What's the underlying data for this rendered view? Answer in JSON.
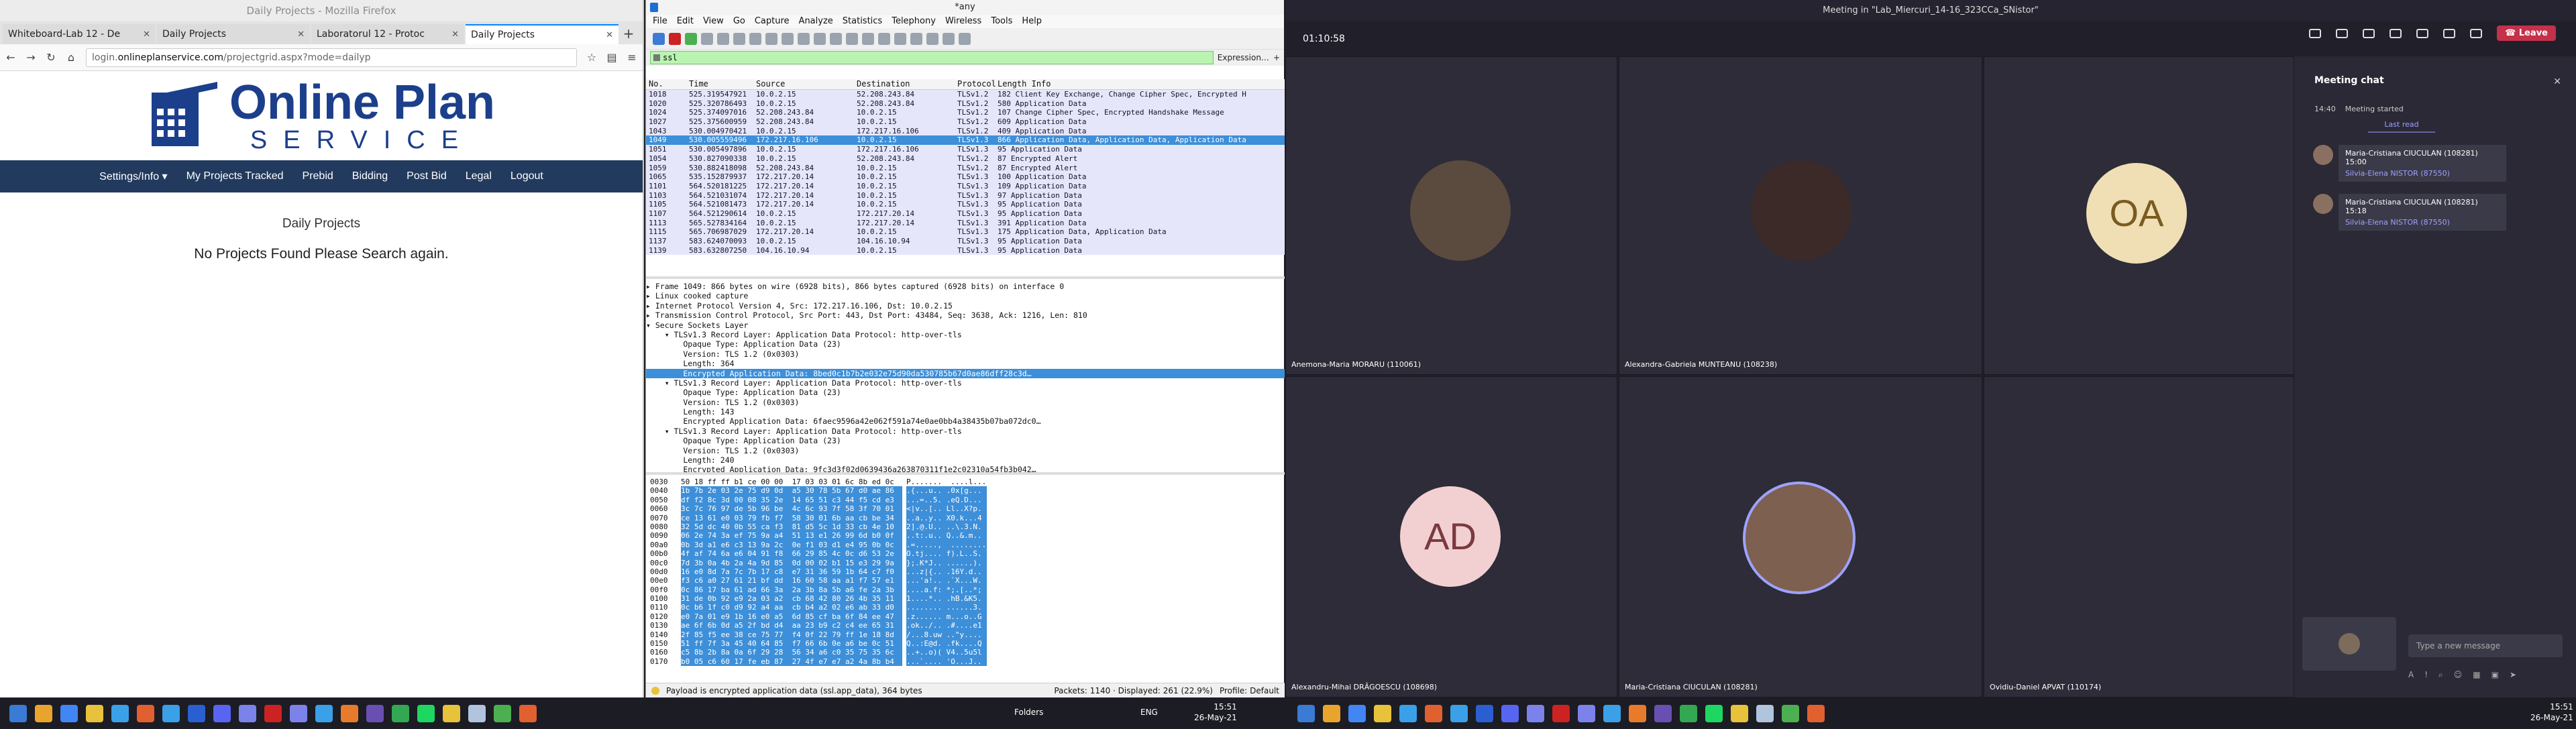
{
  "firefox": {
    "window_title": "Daily Projects - Mozilla Firefox",
    "tabs": [
      {
        "label": "Whiteboard-Lab 12 - De"
      },
      {
        "label": "Daily Projects"
      },
      {
        "label": "Laboratorul 12 - Protoc"
      },
      {
        "label": "Daily Projects"
      }
    ],
    "url_prefix": "login.",
    "url_host": "onlineplanservice.com",
    "url_path": "/projectgrid.aspx?mode=dailyp",
    "site": {
      "logo_line1": "Online Plan",
      "logo_line2": "SERVICE",
      "menu": [
        "Settings/Info ▾",
        "My Projects Tracked",
        "Prebid",
        "Bidding",
        "Post Bid",
        "Legal",
        "Logout"
      ],
      "heading": "Daily Projects",
      "message": "No Projects Found Please Search again."
    }
  },
  "wireshark": {
    "window_title": "*any",
    "menu": [
      "File",
      "Edit",
      "View",
      "Go",
      "Capture",
      "Analyze",
      "Statistics",
      "Telephony",
      "Wireless",
      "Tools",
      "Help"
    ],
    "filter": "ssl",
    "expression_label": "Expression…",
    "columns": [
      "No.",
      "Time",
      "Source",
      "Destination",
      "Protocol",
      "Length",
      "Info"
    ],
    "packets": [
      {
        "no": "1018",
        "time": "525.319547921",
        "src": "10.0.2.15",
        "dst": "52.208.243.84",
        "proto": "TLSv1.2",
        "len": "182",
        "info": "Client Key Exchange, Change Cipher Spec, Encrypted H"
      },
      {
        "no": "1020",
        "time": "525.320786493",
        "src": "10.0.2.15",
        "dst": "52.208.243.84",
        "proto": "TLSv1.2",
        "len": "580",
        "info": "Application Data"
      },
      {
        "no": "1024",
        "time": "525.374097016",
        "src": "52.208.243.84",
        "dst": "10.0.2.15",
        "proto": "TLSv1.2",
        "len": "107",
        "info": "Change Cipher Spec, Encrypted Handshake Message"
      },
      {
        "no": "1027",
        "time": "525.375600959",
        "src": "52.208.243.84",
        "dst": "10.0.2.15",
        "proto": "TLSv1.2",
        "len": "609",
        "info": "Application Data"
      },
      {
        "no": "1043",
        "time": "530.004970421",
        "src": "10.0.2.15",
        "dst": "172.217.16.106",
        "proto": "TLSv1.2",
        "len": "409",
        "info": "Application Data"
      },
      {
        "no": "1049",
        "time": "530.005559496",
        "src": "172.217.16.106",
        "dst": "10.0.2.15",
        "proto": "TLSv1.3",
        "len": "866",
        "info": "Application Data, Application Data, Application Data",
        "selected": true
      },
      {
        "no": "1051",
        "time": "530.005497896",
        "src": "10.0.2.15",
        "dst": "172.217.16.106",
        "proto": "TLSv1.3",
        "len": "95",
        "info": "Application Data"
      },
      {
        "no": "1054",
        "time": "530.827090338",
        "src": "10.0.2.15",
        "dst": "52.208.243.84",
        "proto": "TLSv1.2",
        "len": "87",
        "info": "Encrypted Alert"
      },
      {
        "no": "1059",
        "time": "530.882418098",
        "src": "52.208.243.84",
        "dst": "10.0.2.15",
        "proto": "TLSv1.2",
        "len": "87",
        "info": "Encrypted Alert"
      },
      {
        "no": "1065",
        "time": "535.152879937",
        "src": "172.217.20.14",
        "dst": "10.0.2.15",
        "proto": "TLSv1.3",
        "len": "100",
        "info": "Application Data"
      },
      {
        "no": "1101",
        "time": "564.520181225",
        "src": "172.217.20.14",
        "dst": "10.0.2.15",
        "proto": "TLSv1.3",
        "len": "109",
        "info": "Application Data"
      },
      {
        "no": "1103",
        "time": "564.521031074",
        "src": "172.217.20.14",
        "dst": "10.0.2.15",
        "proto": "TLSv1.3",
        "len": "97",
        "info": "Application Data"
      },
      {
        "no": "1105",
        "time": "564.521081473",
        "src": "172.217.20.14",
        "dst": "10.0.2.15",
        "proto": "TLSv1.3",
        "len": "95",
        "info": "Application Data"
      },
      {
        "no": "1107",
        "time": "564.521290614",
        "src": "10.0.2.15",
        "dst": "172.217.20.14",
        "proto": "TLSv1.3",
        "len": "95",
        "info": "Application Data"
      },
      {
        "no": "1113",
        "time": "565.527834164",
        "src": "10.0.2.15",
        "dst": "172.217.20.14",
        "proto": "TLSv1.3",
        "len": "391",
        "info": "Application Data"
      },
      {
        "no": "1115",
        "time": "565.706987029",
        "src": "172.217.20.14",
        "dst": "10.0.2.15",
        "proto": "TLSv1.3",
        "len": "175",
        "info": "Application Data, Application Data"
      },
      {
        "no": "1137",
        "time": "583.624070093",
        "src": "10.0.2.15",
        "dst": "104.16.10.94",
        "proto": "TLSv1.3",
        "len": "95",
        "info": "Application Data"
      },
      {
        "no": "1139",
        "time": "583.632807250",
        "src": "104.16.10.94",
        "dst": "10.0.2.15",
        "proto": "TLSv1.3",
        "len": "95",
        "info": "Application Data"
      }
    ],
    "details": [
      {
        "text": "▸ Frame 1049: 866 bytes on wire (6928 bits), 866 bytes captured (6928 bits) on interface 0"
      },
      {
        "text": "▸ Linux cooked capture"
      },
      {
        "text": "▸ Internet Protocol Version 4, Src: 172.217.16.106, Dst: 10.0.2.15"
      },
      {
        "text": "▸ Transmission Control Protocol, Src Port: 443, Dst Port: 43484, Seq: 3638, Ack: 1216, Len: 810"
      },
      {
        "text": "▾ Secure Sockets Layer"
      },
      {
        "text": "    ▾ TLSv1.3 Record Layer: Application Data Protocol: http-over-tls"
      },
      {
        "text": "        Opaque Type: Application Data (23)"
      },
      {
        "text": "        Version: TLS 1.2 (0x0303)"
      },
      {
        "text": "        Length: 364"
      },
      {
        "text": "        Encrypted Application Data: 8bed0c1b7b2e032e75d90da530785b67d0ae86dff28c3d…",
        "selected": true
      },
      {
        "text": "    ▾ TLSv1.3 Record Layer: Application Data Protocol: http-over-tls"
      },
      {
        "text": "        Opaque Type: Application Data (23)"
      },
      {
        "text": "        Version: TLS 1.2 (0x0303)"
      },
      {
        "text": "        Length: 143"
      },
      {
        "text": "        Encrypted Application Data: 6faec9596a42e062f591a74e0ae0bb4a38435b07ba072dc0…"
      },
      {
        "text": "    ▾ TLSv1.3 Record Layer: Application Data Protocol: http-over-tls"
      },
      {
        "text": "        Opaque Type: Application Data (23)"
      },
      {
        "text": "        Version: TLS 1.2 (0x0303)"
      },
      {
        "text": "        Length: 240"
      },
      {
        "text": "        Encrypted Application Data: 9fc3d3f02d0639436a263870311f1e2c02310a54fb3b042…"
      },
      {
        "text": "    ▸ TLSv1.3 Record Layer: Application Data Protocol: http-over-tls"
      }
    ],
    "bytes": [
      {
        "off": "0030",
        "hex": "50 18 ff ff b1 ce 00 00  17 03 03 01 6c 8b ed 0c",
        "asc": "P.......  ....l...",
        "hi": false
      },
      {
        "off": "0040",
        "hex": "1b 7b 2e 03 2e 75 d9 0d  a5 30 78 5b 67 d0 ae 86",
        "asc": ".{...u.. .0x[g...",
        "hi": true
      },
      {
        "off": "0050",
        "hex": "df f2 8c 3d 00 08 35 2e  14 65 51 c3 44 f5 cd e3",
        "asc": "...=..5. .eQ.D...",
        "hi": true
      },
      {
        "off": "0060",
        "hex": "3c 7c 76 97 de 5b 96 be  4c 6c 93 7f 58 3f 70 01",
        "asc": "<|v..[.. Ll..X?p.",
        "hi": true
      },
      {
        "off": "0070",
        "hex": "ce 13 61 e0 03 79 fb f7  58 30 01 6b aa cb be 34",
        "asc": "..a..y.. X0.k...4",
        "hi": true
      },
      {
        "off": "0080",
        "hex": "32 5d dc 40 0b 55 ca f3  81 d5 5c 1d 33 cb 4e 10",
        "asc": "2].@.U.. ..\\.3.N.",
        "hi": true
      },
      {
        "off": "0090",
        "hex": "06 2e 74 3a ef 75 9a a4  51 13 e1 26 99 6d b0 0f",
        "asc": "..t:.u.. Q..&.m..",
        "hi": true
      },
      {
        "off": "00a0",
        "hex": "0b 3d a1 e6 c3 13 9a 2c  0e f1 03 d1 e4 95 0b 0c",
        "asc": ".=.....,  ........",
        "hi": true
      },
      {
        "off": "00b0",
        "hex": "4f af 74 6a e6 04 91 f8  66 29 85 4c 0c d6 53 2e",
        "asc": "O.tj.... f).L..S.",
        "hi": true
      },
      {
        "off": "00c0",
        "hex": "7d 3b 0a 4b 2a 4a 9d 85  0d 00 02 b1 15 e3 29 9a",
        "asc": "};.K*J.. ......).",
        "hi": true
      },
      {
        "off": "00d0",
        "hex": "16 e0 8d 7a 7c 7b 17 c8  e7 31 36 59 1b 64 c7 f0",
        "asc": "...z|{.. .16Y.d..",
        "hi": true
      },
      {
        "off": "00e0",
        "hex": "f3 c6 a0 27 61 21 bf dd  16 60 58 aa a1 f7 57 e1",
        "asc": "...'a!.. .`X...W.",
        "hi": true
      },
      {
        "off": "00f0",
        "hex": "0c 86 17 ba 61 ad 66 3a  2a 3b 8a 5b a6 fe 2a 3b",
        "asc": "....a.f: *;.[..*;",
        "hi": true
      },
      {
        "off": "0100",
        "hex": "31 de 0b 92 e9 2a 03 a2  cb 68 42 80 26 4b 35 11",
        "asc": "1....*.. .hB.&K5.",
        "hi": true
      },
      {
        "off": "0110",
        "hex": "0c b6 1f c0 d9 92 a4 aa  cb b4 a2 02 e6 ab 33 d0",
        "asc": "........ ......3.",
        "hi": true
      },
      {
        "off": "0120",
        "hex": "e0 7a 01 e9 1b 16 e0 a5  6d 85 cf ba 6f 84 ee 47",
        "asc": ".z...... m...o..G",
        "hi": true
      },
      {
        "off": "0130",
        "hex": "ae 6f 6b 0d a5 2f bd d4  aa 23 b9 c2 c4 ee 65 31",
        "asc": ".ok../.. .#....e1",
        "hi": true
      },
      {
        "off": "0140",
        "hex": "2f 85 f5 ee 38 ce 75 77  f4 0f 22 79 ff 1e 18 8d",
        "asc": "/...8.uw ..\"y....",
        "hi": true
      },
      {
        "off": "0150",
        "hex": "51 ff 7f 3a 45 40 64 85  f7 66 6b 0e a6 be 0c 51",
        "asc": "Q..:E@d. .fk....Q",
        "hi": true
      },
      {
        "off": "0160",
        "hex": "c5 8b 2b 8a 0a 6f 29 28  56 34 a6 c0 35 75 35 6c",
        "asc": "..+..o)( V4..5u5l",
        "hi": true
      },
      {
        "off": "0170",
        "hex": "b0 05 c6 60 17 fe eb 87  27 4f e7 e7 a2 4a 8b b4",
        "asc": "...`.... 'O...J..",
        "hi": true
      }
    ],
    "status_left": "Payload is encrypted application data (ssl.app_data), 364 bytes",
    "status_packets": "Packets: 1140 · Displayed: 261 (22.9%)",
    "status_profile": "Profile: Default"
  },
  "teams": {
    "window_title": "Meeting in \"Lab_Miercuri_14-16_323CCa_SNistor\"",
    "call_timer": "01:10:58",
    "leave_label": "Leave",
    "participants": [
      {
        "name": "Anemona-Maria MORARU (110061)",
        "initials": "",
        "color": "#5b4a3e"
      },
      {
        "name": "Alexandra-Gabriela MUNTEANU (108238)",
        "initials": "",
        "color": "#3b2a28"
      },
      {
        "name": "",
        "initials": "OA",
        "color": "#f0dfb5"
      },
      {
        "name": "Alexandru-Mihai DRĂGOESCU (108698)",
        "initials": "AD",
        "color": "#f2d0d2"
      },
      {
        "name": "Maria-Cristiana CIUCULAN (108281)",
        "initials": "",
        "color": "#7d6050"
      },
      {
        "name": "Ovidiu-Daniel APVAT (110174)",
        "initials": "",
        "color": "#2d2c38"
      }
    ],
    "chat": {
      "title": "Meeting chat",
      "sys_time": "14:40",
      "sys_text": "Meeting started",
      "last_read": "Last read",
      "messages": [
        {
          "author": "Maria-Cristiana CIUCULAN (108281)",
          "time": "15:00",
          "to": "Silvia-Elena NISTOR (87550)"
        },
        {
          "author": "Maria-Cristiana CIUCULAN (108281)",
          "time": "15:18",
          "to": "Silvia-Elena NISTOR (87550)"
        }
      ],
      "input_placeholder": "Type a new message"
    }
  },
  "taskbar": {
    "lang": "ENG",
    "folders_label": "Folders",
    "clock_left_time": "15:51",
    "clock_left_date": "26-May-21",
    "clock_right_time": "15:51",
    "clock_right_date": "26-May-21",
    "icon_colors": [
      "#e8a42c",
      "#4285f4",
      "#e8c23a",
      "#3aa0e8",
      "#e06030",
      "#3aa0e8",
      "#2a5fd1",
      "#5865f2",
      "#7b83eb",
      "#cc2222",
      "#7b83eb",
      "#3aa0e8",
      "#e87a2c",
      "#6a4fb3",
      "#33a852",
      "#1ed760",
      "#e8c23a",
      "#b0c4de",
      "#4caf50",
      "#e06030"
    ]
  }
}
